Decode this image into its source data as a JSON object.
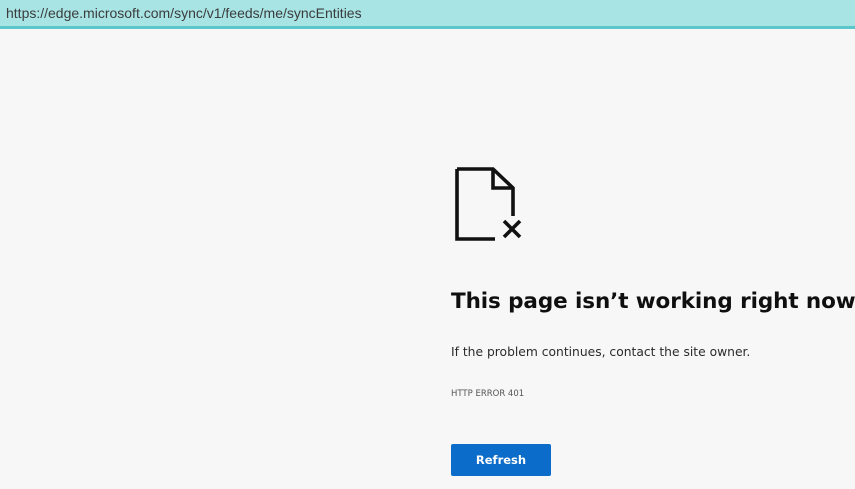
{
  "address_bar": {
    "url": "https://edge.microsoft.com/sync/v1/feeds/me/syncEntities"
  },
  "error": {
    "icon": "document-error-icon",
    "title": "This page isn’t working right now",
    "message": "If the problem continues, contact the site owner.",
    "code": "HTTP ERROR 401",
    "refresh_label": "Refresh"
  },
  "colors": {
    "address_bar_bg": "#a8e4e4",
    "address_bar_border": "#5cc7cb",
    "page_bg": "#f7f7f7",
    "button_bg": "#0b6cc9"
  }
}
